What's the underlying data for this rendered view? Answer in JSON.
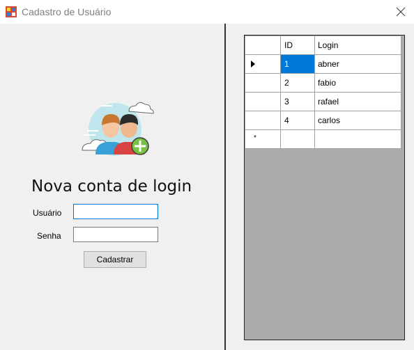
{
  "window": {
    "title": "Cadastro de Usuário",
    "icon": "app-form-icon",
    "close_icon": "close-icon"
  },
  "form": {
    "heading": "Nova conta de login",
    "usuario_label": "Usuário",
    "usuario_value": "",
    "senha_label": "Senha",
    "senha_value": "",
    "submit_label": "Cadastrar",
    "illustration": "users-add-illustration"
  },
  "grid": {
    "columns": [
      "ID",
      "Login"
    ],
    "rows": [
      {
        "id": "1",
        "login": "abner"
      },
      {
        "id": "2",
        "login": "fabio"
      },
      {
        "id": "3",
        "login": "rafael"
      },
      {
        "id": "4",
        "login": "carlos"
      }
    ],
    "new_row_marker": "*",
    "current_row_marker": "row-indicator-arrow"
  },
  "colors": {
    "selection": "#0078d7",
    "grid_background": "#ababab",
    "window_background": "#f0f0f0"
  }
}
